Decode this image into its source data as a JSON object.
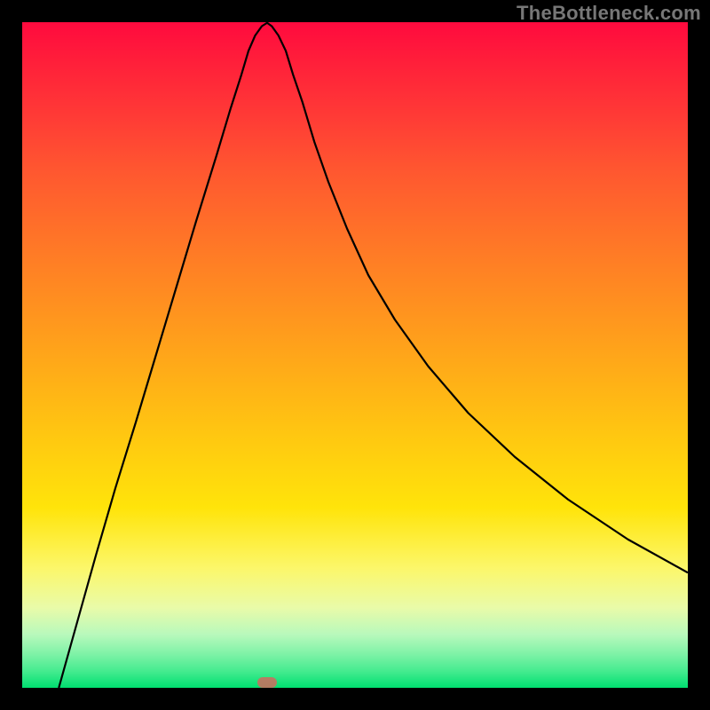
{
  "watermark": "TheBottleneck.com",
  "accent_marker_color": "#d06a5e",
  "chart_data": {
    "type": "line",
    "title": "",
    "xlabel": "",
    "ylabel": "",
    "xlim_norm": [
      0,
      1
    ],
    "ylim_norm": [
      0,
      1
    ],
    "ylim_label": null,
    "xlim_label": null,
    "grid": false,
    "legend": false,
    "curve_description": "V-shaped curve with a single minimum; left branch nearly linear from top-left to bottom, right branch concave increasing asymptotically toward the right",
    "series": [
      {
        "name": "curve",
        "points_norm": [
          [
            0.055,
            0.0
          ],
          [
            0.083,
            0.1
          ],
          [
            0.111,
            0.2
          ],
          [
            0.14,
            0.3
          ],
          [
            0.171,
            0.4
          ],
          [
            0.201,
            0.5
          ],
          [
            0.231,
            0.6
          ],
          [
            0.261,
            0.7
          ],
          [
            0.292,
            0.8
          ],
          [
            0.313,
            0.87
          ],
          [
            0.329,
            0.92
          ],
          [
            0.34,
            0.957
          ],
          [
            0.35,
            0.98
          ],
          [
            0.36,
            0.994
          ],
          [
            0.368,
            0.999
          ],
          [
            0.375,
            0.994
          ],
          [
            0.385,
            0.98
          ],
          [
            0.396,
            0.957
          ],
          [
            0.407,
            0.921
          ],
          [
            0.421,
            0.88
          ],
          [
            0.439,
            0.82
          ],
          [
            0.46,
            0.76
          ],
          [
            0.488,
            0.69
          ],
          [
            0.52,
            0.62
          ],
          [
            0.56,
            0.553
          ],
          [
            0.61,
            0.483
          ],
          [
            0.67,
            0.413
          ],
          [
            0.74,
            0.347
          ],
          [
            0.82,
            0.283
          ],
          [
            0.91,
            0.223
          ],
          [
            1.0,
            0.173
          ]
        ]
      }
    ],
    "marker_norm": [
      0.368,
      1.0
    ]
  }
}
